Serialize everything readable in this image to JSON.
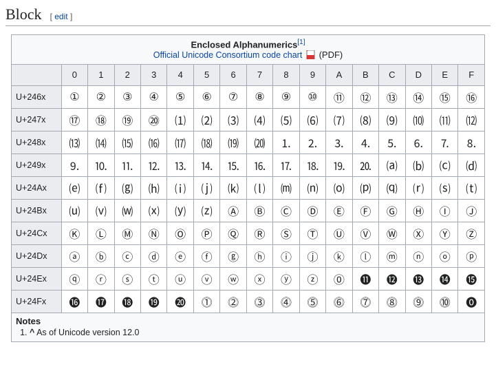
{
  "section": {
    "title": "Block",
    "edit_open": "[",
    "edit_label": "edit",
    "edit_close": "]"
  },
  "chart": {
    "title": "Enclosed Alphanumerics",
    "ref": "[1]",
    "link_label": "Official Unicode Consortium code chart",
    "pdf_label": "(PDF)"
  },
  "cols": [
    "0",
    "1",
    "2",
    "3",
    "4",
    "5",
    "6",
    "7",
    "8",
    "9",
    "A",
    "B",
    "C",
    "D",
    "E",
    "F"
  ],
  "rows": [
    {
      "header": "U+246x",
      "glyphs": [
        "①",
        "②",
        "③",
        "④",
        "⑤",
        "⑥",
        "⑦",
        "⑧",
        "⑨",
        "⑩",
        "⑪",
        "⑫",
        "⑬",
        "⑭",
        "⑮",
        "⑯"
      ]
    },
    {
      "header": "U+247x",
      "glyphs": [
        "⑰",
        "⑱",
        "⑲",
        "⑳",
        "⑴",
        "⑵",
        "⑶",
        "⑷",
        "⑸",
        "⑹",
        "⑺",
        "⑻",
        "⑼",
        "⑽",
        "⑾",
        "⑿"
      ]
    },
    {
      "header": "U+248x",
      "glyphs": [
        "⒀",
        "⒁",
        "⒂",
        "⒃",
        "⒄",
        "⒅",
        "⒆",
        "⒇",
        "⒈",
        "⒉",
        "⒊",
        "⒋",
        "⒌",
        "⒍",
        "⒎",
        "⒏"
      ]
    },
    {
      "header": "U+249x",
      "glyphs": [
        "⒐",
        "⒑",
        "⒒",
        "⒓",
        "⒔",
        "⒕",
        "⒖",
        "⒗",
        "⒘",
        "⒙",
        "⒚",
        "⒛",
        "⒜",
        "⒝",
        "⒞",
        "⒟"
      ]
    },
    {
      "header": "U+24Ax",
      "glyphs": [
        "⒠",
        "⒡",
        "⒢",
        "⒣",
        "⒤",
        "⒥",
        "⒦",
        "⒧",
        "⒨",
        "⒩",
        "⒪",
        "⒫",
        "⒬",
        "⒭",
        "⒮",
        "⒯"
      ]
    },
    {
      "header": "U+24Bx",
      "glyphs": [
        "⒰",
        "⒱",
        "⒲",
        "⒳",
        "⒴",
        "⒵",
        "Ⓐ",
        "Ⓑ",
        "Ⓒ",
        "Ⓓ",
        "Ⓔ",
        "Ⓕ",
        "Ⓖ",
        "Ⓗ",
        "Ⓘ",
        "Ⓙ"
      ]
    },
    {
      "header": "U+24Cx",
      "glyphs": [
        "Ⓚ",
        "Ⓛ",
        "Ⓜ",
        "Ⓝ",
        "Ⓞ",
        "Ⓟ",
        "Ⓠ",
        "Ⓡ",
        "Ⓢ",
        "Ⓣ",
        "Ⓤ",
        "Ⓥ",
        "Ⓦ",
        "Ⓧ",
        "Ⓨ",
        "Ⓩ"
      ]
    },
    {
      "header": "U+24Dx",
      "glyphs": [
        "ⓐ",
        "ⓑ",
        "ⓒ",
        "ⓓ",
        "ⓔ",
        "ⓕ",
        "ⓖ",
        "ⓗ",
        "ⓘ",
        "ⓙ",
        "ⓚ",
        "ⓛ",
        "ⓜ",
        "ⓝ",
        "ⓞ",
        "ⓟ"
      ]
    },
    {
      "header": "U+24Ex",
      "glyphs": [
        "ⓠ",
        "ⓡ",
        "ⓢ",
        "ⓣ",
        "ⓤ",
        "ⓥ",
        "ⓦ",
        "ⓧ",
        "ⓨ",
        "ⓩ",
        "⓪",
        "⓫",
        "⓬",
        "⓭",
        "⓮",
        "⓯"
      ]
    },
    {
      "header": "U+24Fx",
      "glyphs": [
        "⓰",
        "⓱",
        "⓲",
        "⓳",
        "⓴",
        "⓵",
        "⓶",
        "⓷",
        "⓸",
        "⓹",
        "⓺",
        "⓻",
        "⓼",
        "⓽",
        "⓾",
        "⓿"
      ]
    }
  ],
  "notes": {
    "title": "Notes",
    "item_marker": "^",
    "item_text": " As of Unicode version 12.0"
  },
  "chart_data": {
    "type": "table",
    "block_name": "Enclosed Alphanumerics",
    "codepoint_start": "U+2460",
    "codepoint_end": "U+24FF",
    "unicode_version": "12.0"
  }
}
